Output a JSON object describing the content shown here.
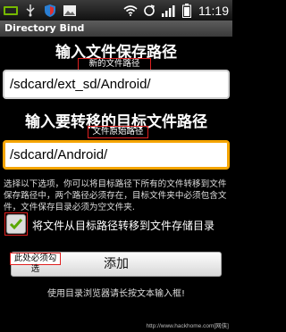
{
  "status_bar": {
    "left_icons": [
      "nvidia-icon",
      "usb-icon",
      "shield-icon",
      "image-icon"
    ],
    "right_icons": [
      "wifi-icon",
      "sync-icon",
      "signal-icon",
      "battery-icon"
    ],
    "time": "11:19"
  },
  "app": {
    "title": "Directory Bind"
  },
  "section1": {
    "heading": "输入文件保存路径",
    "annotation": "新的文件路径",
    "input_value": "/sdcard/ext_sd/Android/"
  },
  "section2": {
    "heading": "输入要转移的目标文件路径",
    "annotation": "文件原始路径",
    "input_value": "/sdcard/Android/"
  },
  "description": "选择以下选项，你可以将目标路径下所有的文件转移到文件保存路径中，两个路径必须存在，目标文件夹中必须包含文件，文件保存目录必须为空文件夹.",
  "option": {
    "checked": true,
    "label": "将文件从目标路径转移到文件存储目录",
    "annotation": "此处必须勾选"
  },
  "add_button": {
    "label": "添加"
  },
  "hint": "使用目录浏览器请长按文本输入框!",
  "watermark": "http://www.hackhome.com[网侠]"
}
